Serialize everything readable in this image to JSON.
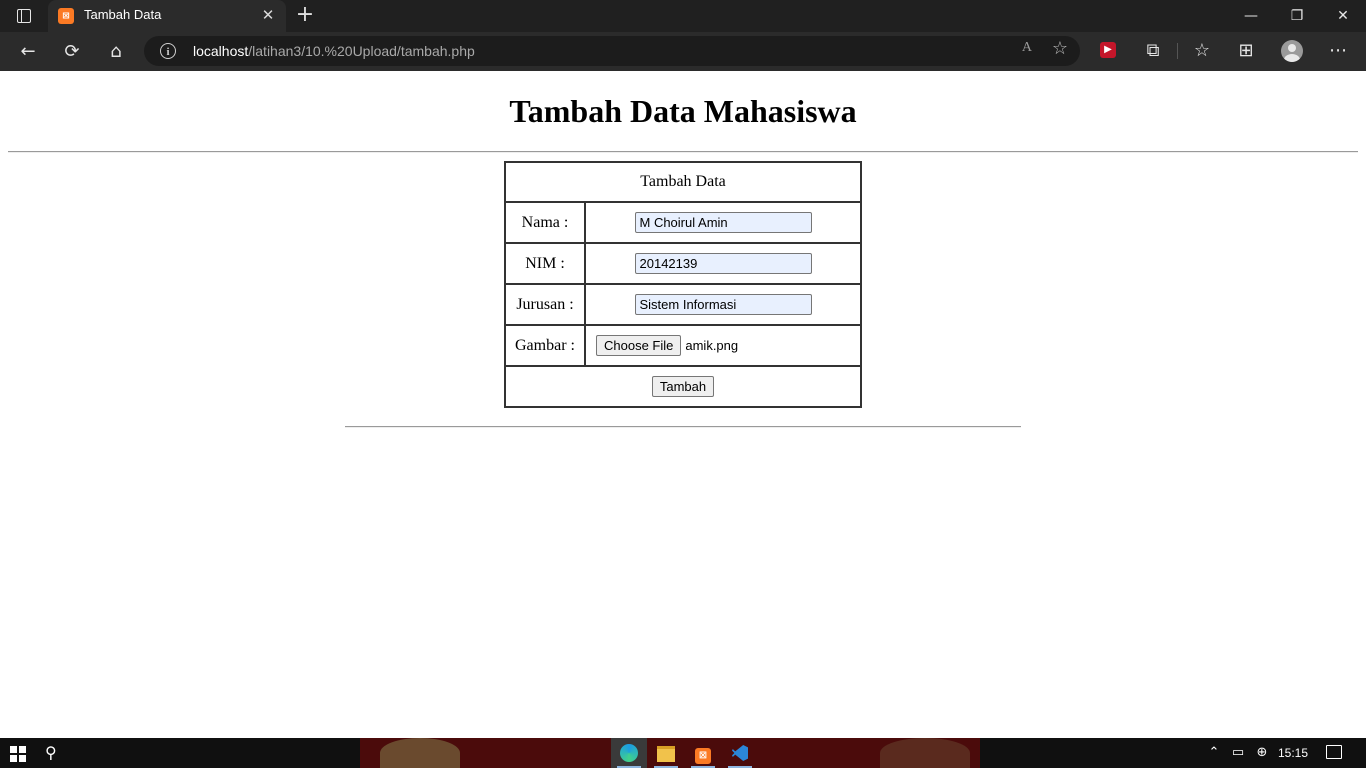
{
  "browser": {
    "tab_title": "Tambah Data",
    "address_host": "localhost",
    "address_path": "/latihan3/10.%20Upload/tambah.php",
    "tab_close_glyph": "✕",
    "new_tab_glyph": "+",
    "window_controls": {
      "minimize": "—",
      "restore": "❐",
      "close": "✕"
    },
    "icons": {
      "back": "←",
      "refresh": "⟳",
      "home": "⌂",
      "favorite": "☆",
      "extensions": "⧉",
      "favorites_bar": "☆",
      "collections": "⊞",
      "more": "⋯",
      "read_aloud": "A"
    }
  },
  "page": {
    "heading": "Tambah Data Mahasiswa",
    "form_caption": "Tambah Data",
    "fields": [
      {
        "label": "Nama :",
        "value": "M Choirul Amin"
      },
      {
        "label": "NIM :",
        "value": "20142139"
      },
      {
        "label": "Jurusan :",
        "value": "Sistem Informasi"
      }
    ],
    "file_field": {
      "label": "Gambar :",
      "button": "Choose File",
      "file_name": "amik.png"
    },
    "submit_label": "Tambah"
  },
  "taskbar": {
    "time": "15:15",
    "tray_chevron": "⌃",
    "tray_battery": "▭",
    "tray_network": "⊕"
  }
}
